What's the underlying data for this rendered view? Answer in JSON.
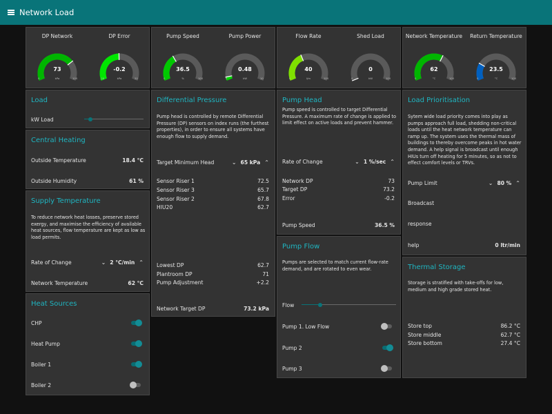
{
  "header": {
    "title": "Network Load"
  },
  "gauges": {
    "dp_network": {
      "title": "DP Network",
      "value": "73",
      "value_num": 73,
      "min": 0,
      "max": 100,
      "unit": "kPa",
      "color": "#00b500"
    },
    "dp_error": {
      "title": "DP Error",
      "value": "-0.2",
      "value_num": -0.2,
      "min": -20,
      "max": 20,
      "unit": "kPa",
      "color": "#00e600"
    },
    "pump_speed": {
      "title": "Pump Speed",
      "value": "36.5",
      "value_num": 36.5,
      "min": 0,
      "max": 100,
      "unit": "%",
      "color": "#00c800"
    },
    "pump_power": {
      "title": "Pump Power",
      "value": "0.48",
      "value_num": 0.48,
      "min": 0,
      "max": 10,
      "unit": "kW",
      "color": "#00d000"
    },
    "flow_rate": {
      "title": "Flow Rate",
      "value": "40",
      "value_num": 40,
      "min": 0,
      "max": 100,
      "unit": "l/m",
      "color": "#7fe000"
    },
    "shed_load": {
      "title": "Shed Load",
      "value": "0",
      "value_num": 0,
      "min": 0,
      "max": 100,
      "unit": "kW",
      "color": "#00c800"
    },
    "network_temp": {
      "title": "Network Temperature",
      "value": "62",
      "value_num": 62,
      "min": 0,
      "max": 100,
      "unit": "°C",
      "color": "#00b500"
    },
    "return_temp": {
      "title": "Return Temperature",
      "value": "23.5",
      "value_num": 23.5,
      "min": 0,
      "max": 100,
      "unit": "°C",
      "color": "#0060c0"
    }
  },
  "load": {
    "title": "Load",
    "kw_label": "kW Load",
    "kw_level": 0.08
  },
  "central_heating": {
    "title": "Central Heating",
    "outside_temp_label": "Outside Temperature",
    "outside_temp": "18.4 °C",
    "outside_humidity_label": "Outside Humidity",
    "outside_humidity": "61 %"
  },
  "supply_temperature": {
    "title": "Supply Temperature",
    "description": "To reduce network heat losses, preserve stored exergy, and maximise the efficiency of available heat sources, flow temperature are kept as low as load permits.",
    "roc_label": "Rate of Change",
    "roc_value": "2 °C/min",
    "network_temp_label": "Network Temperature",
    "network_temp_value": "62 °C"
  },
  "heat_sources": {
    "title": "Heat Sources",
    "items": [
      {
        "label": "CHP",
        "on": true
      },
      {
        "label": "Heat Pump",
        "on": true
      },
      {
        "label": "Boiler 1",
        "on": true
      },
      {
        "label": "Boiler 2",
        "on": false
      }
    ]
  },
  "differential_pressure": {
    "title": "Differential Pressure",
    "description": "Pump head is controlled by remote Differential Pressure (DP) sensors on index runs (the furthest properties), in order to ensure all systems have enough flow to supply demand.",
    "target_label": "Target Minimum Head",
    "target_value": "65 kPa",
    "sensors": [
      {
        "label": "Sensor Riser 1",
        "value": "72.5"
      },
      {
        "label": "Sensor Riser 3",
        "value": "65.7"
      },
      {
        "label": "Sensor Riser 2",
        "value": "67.8"
      },
      {
        "label": "HIU20",
        "value": "62.7"
      }
    ],
    "summary": [
      {
        "label": "Lowest DP",
        "value": "62.7"
      },
      {
        "label": "Plantroom DP",
        "value": "71"
      },
      {
        "label": "Pump Adjustment",
        "value": "+2.2"
      }
    ],
    "network_target_label": "Network Target DP",
    "network_target_value": "73.2 kPa"
  },
  "pump_head": {
    "title": "Pump Head",
    "description": "Pump speed is controlled to target Differential Pressure. A maximum rate of change is applied to limit effect on active loads and prevent hammer.",
    "roc_label": "Rate of Change",
    "roc_value": "1 %/sec",
    "rows": [
      {
        "label": "Network DP",
        "value": "73"
      },
      {
        "label": "Target DP",
        "value": "73.2"
      },
      {
        "label": "Error",
        "value": "-0.2"
      }
    ],
    "pump_speed_label": "Pump Speed",
    "pump_speed_value": "36.5 %"
  },
  "pump_flow": {
    "title": "Pump Flow",
    "description": "Pumps are selected to match current flow-rate demand, and are rotated to even wear.",
    "flow_label": "Flow",
    "flow_level": 0.18,
    "pumps": [
      {
        "label": "Pump 1. Low Flow",
        "on": false
      },
      {
        "label": "Pump 2",
        "on": true
      },
      {
        "label": "Pump 3",
        "on": false
      }
    ]
  },
  "load_prioritisation": {
    "title": "Load Prioritisation",
    "description": "Sytem wide load priority comes into play as pumps approach full load, shedding non-critical loads until the heat network temperature can ramp up. The system uses the thermal mass of buildings to thereby overcome peaks in hot water demand. A help signal is broadcast until enough HIUs turn off heating for 5 minutes, so as not to effect comfort levels or TRVs.",
    "pump_limit_label": "Pump Limit",
    "pump_limit_value": "80 %",
    "broadcast_label": "Broadcast",
    "response_label": "response",
    "help_label": "help",
    "help_value": "0 ltr/min"
  },
  "thermal_storage": {
    "title": "Thermal Storage",
    "description": "Storage is stratified with take-offs for low, medium and high grade stored heat.",
    "rows": [
      {
        "label": "Store top",
        "value": "86.2 °C"
      },
      {
        "label": "Store middle",
        "value": "62.7 °C"
      },
      {
        "label": "Store bottom",
        "value": "27.4 °C"
      }
    ]
  },
  "icons": {
    "menu": "menu-icon",
    "chevron_down": "chevron-down-icon",
    "chevron_up": "chevron-up-icon"
  },
  "colors": {
    "header": "#097479",
    "accent": "#1fb6c2",
    "card": "#333333",
    "background": "#111111"
  }
}
